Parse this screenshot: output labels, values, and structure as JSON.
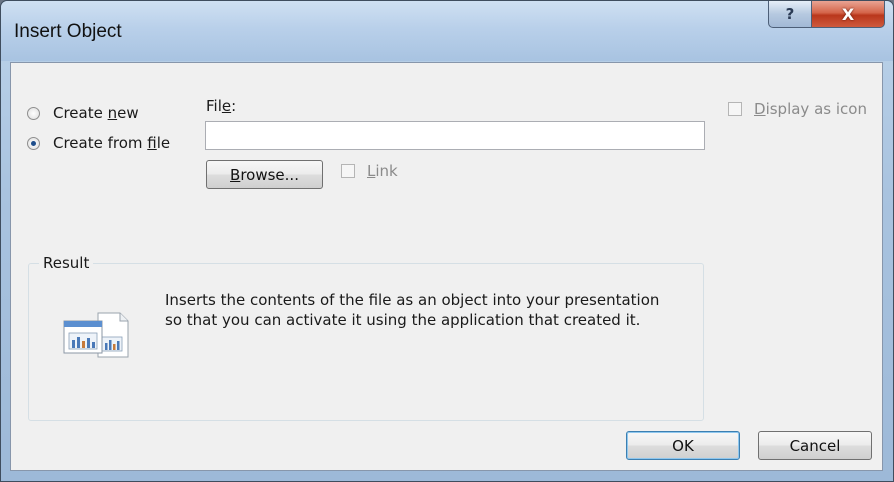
{
  "window": {
    "title": "Insert Object",
    "help_glyph": "?",
    "close_glyph": "X"
  },
  "options": {
    "create_new": {
      "before": "Create ",
      "key": "n",
      "after": "ew",
      "checked": false
    },
    "create_from_file": {
      "before": "Create from ",
      "key": "f",
      "after": "ile",
      "checked": true
    }
  },
  "file": {
    "label_before": "Fil",
    "label_key": "e",
    "label_after": ":",
    "value": "",
    "placeholder": ""
  },
  "browse": {
    "key": "B",
    "after": "rowse..."
  },
  "link": {
    "key": "L",
    "after": "ink",
    "enabled": false
  },
  "display_as_icon": {
    "key": "D",
    "after": "isplay as icon",
    "enabled": false
  },
  "result": {
    "label": "Result",
    "text": "Inserts the contents of the file as an object into your presentation so that you can activate it using the application that created it."
  },
  "footer": {
    "ok": "OK",
    "cancel": "Cancel"
  },
  "colors": {
    "accent": "#3c7fb1",
    "close": "#c8452a"
  }
}
